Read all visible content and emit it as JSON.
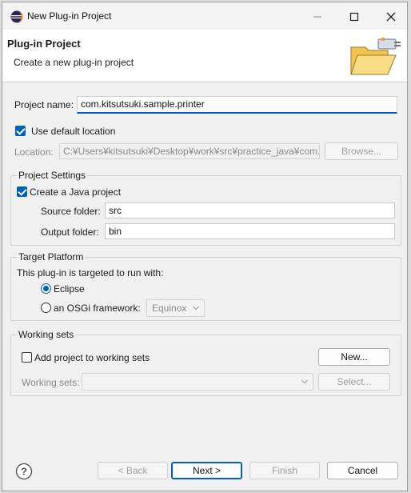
{
  "window": {
    "title": "New Plug-in Project",
    "icon": "eclipse-icon",
    "controls": [
      "minimize-icon",
      "maximize-icon",
      "close-icon"
    ]
  },
  "header": {
    "title": "Plug-in Project",
    "description": "Create a new plug-in project",
    "banner_icon": "wizard-folder-icon"
  },
  "project": {
    "name_label": "Project name:",
    "name_value": "com.kitsutsuki.sample.printer",
    "use_default_location_label": "Use default location",
    "use_default_location_checked": true,
    "location_label": "Location:",
    "location_value": "C:¥Users¥kitsutsuki¥Desktop¥work¥src¥practice_java¥com.kit",
    "browse_label": "Browse..."
  },
  "project_settings": {
    "title": "Project Settings",
    "create_java_label": "Create a Java project",
    "create_java_checked": true,
    "source_label": "Source folder:",
    "source_value": "src",
    "output_label": "Output folder:",
    "output_value": "bin"
  },
  "target_platform": {
    "title": "Target Platform",
    "prompt": "This plug-in is targeted to run with:",
    "eclipse_label": "Eclipse",
    "osgi_label": "an OSGi framework:",
    "selected": "Eclipse",
    "osgi_option": "Equinox"
  },
  "working_sets": {
    "title": "Working sets",
    "add_label": "Add project to working sets",
    "add_checked": false,
    "new_label": "New...",
    "sets_label": "Working sets:",
    "sets_value": "",
    "select_label": "Select..."
  },
  "footer": {
    "help_icon": "help-icon",
    "back_label": "< Back",
    "next_label": "Next >",
    "finish_label": "Finish",
    "cancel_label": "Cancel"
  },
  "colors": {
    "accent": "#005fb8",
    "window_bg": "#f0f0f0",
    "header_bg": "#ffffff"
  }
}
